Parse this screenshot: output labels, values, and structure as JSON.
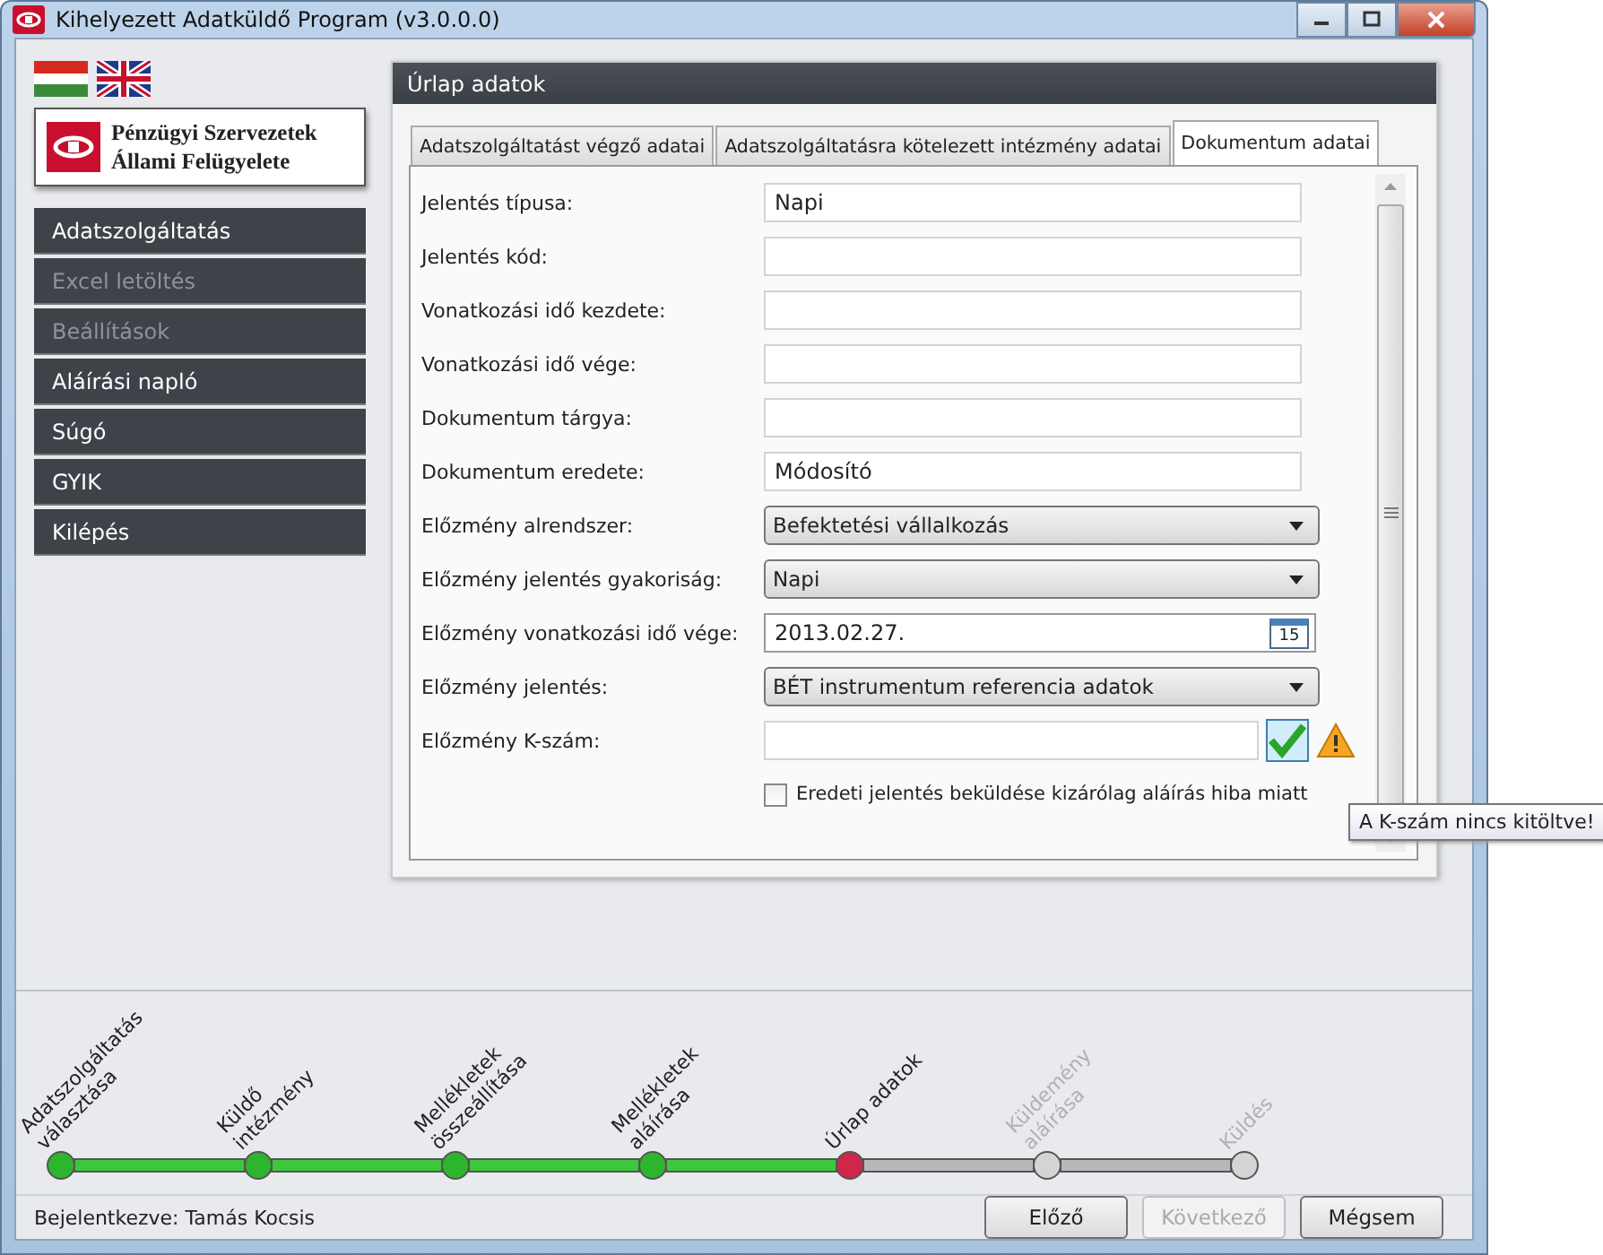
{
  "window": {
    "title": "Kihelyezett Adatküldő Program (v3.0.0.0)"
  },
  "logo": {
    "line1": "Pénzügyi Szervezetek",
    "line2": "Állami Felügyelete"
  },
  "sidebar": {
    "items": [
      {
        "label": "Adatszolgáltatás",
        "disabled": false
      },
      {
        "label": "Excel letöltés",
        "disabled": true
      },
      {
        "label": "Beállítások",
        "disabled": true
      },
      {
        "label": "Aláírási napló",
        "disabled": false
      },
      {
        "label": "Súgó",
        "disabled": false
      },
      {
        "label": "GYIK",
        "disabled": false
      },
      {
        "label": "Kilépés",
        "disabled": false
      }
    ]
  },
  "panel": {
    "title": "Úrlap adatok",
    "tabs": [
      {
        "label": "Adatszolgáltatást végző adatai",
        "selected": false
      },
      {
        "label": "Adatszolgáltatásra kötelezett intézmény adatai",
        "selected": false
      },
      {
        "label": "Dokumentum adatai",
        "selected": true
      }
    ],
    "rows": [
      {
        "kind": "text",
        "label": "Jelentés típusa:",
        "value": "Napi"
      },
      {
        "kind": "text",
        "label": "Jelentés kód:"
      },
      {
        "kind": "text",
        "label": "Vonatkozási idő kezdete:"
      },
      {
        "kind": "text",
        "label": "Vonatkozási idő vége:"
      },
      {
        "kind": "text",
        "label": "Dokumentum tárgya:"
      },
      {
        "kind": "text",
        "label": "Dokumentum eredete:",
        "value": "Módosító"
      },
      {
        "kind": "select",
        "label": "Előzmény alrendszer:",
        "value": "Befektetési vállalkozás"
      },
      {
        "kind": "select",
        "label": "Előzmény jelentés gyakoriság:",
        "value": "Napi"
      },
      {
        "kind": "date",
        "label": "Előzmény vonatkozási idő vége:",
        "value": "2013.02.27.",
        "icon_text": "15"
      },
      {
        "kind": "select",
        "label": "Előzmény jelentés:",
        "value": "BÉT instrumentum referencia adatok"
      },
      {
        "kind": "verify",
        "label": "Előzmény K-szám:"
      }
    ],
    "checkbox": {
      "label": "Eredeti jelentés beküldése kizárólag aláírás hiba miatt",
      "checked": false
    },
    "tooltip": "A K-szám nincs kitöltve!"
  },
  "steps": [
    {
      "label": "Adatszolgáltatás választása",
      "completed": true,
      "selected": false
    },
    {
      "label": "Küldő intézmény",
      "completed": true,
      "selected": false
    },
    {
      "label": "Mellékletek összeállítása",
      "completed": true,
      "selected": false
    },
    {
      "label": "Mellékletek aláírása",
      "completed": true,
      "selected": false
    },
    {
      "label": "Úrlap adatok",
      "completed": false,
      "selected": true
    },
    {
      "label": "Küldemény aláírása",
      "completed": false,
      "selected": false
    },
    {
      "label": "Küldés",
      "completed": false,
      "selected": false
    }
  ],
  "status": "Bejelentkezve: Tamás Kocsis",
  "buttons": [
    {
      "label": "Előző",
      "disabled": false
    },
    {
      "label": "Következő",
      "disabled": true
    },
    {
      "label": "Mégsem",
      "disabled": false
    }
  ]
}
